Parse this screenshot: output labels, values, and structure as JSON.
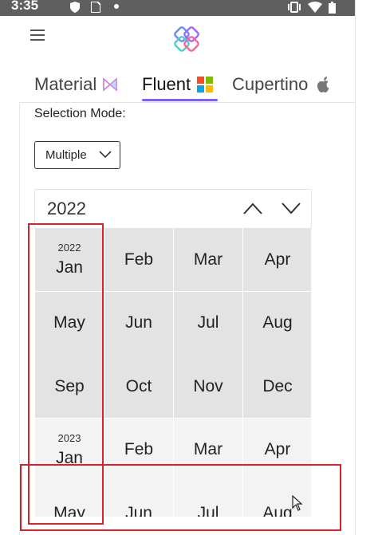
{
  "status": {
    "time": "3:35"
  },
  "tabs": [
    {
      "label": "Material",
      "icon": "material-icon"
    },
    {
      "label": "Fluent",
      "icon": "windows-icon"
    },
    {
      "label": "Cupertino",
      "icon": "apple-icon"
    }
  ],
  "selection_mode": {
    "label": "Selection Mode:",
    "value": "Multiple"
  },
  "calendar": {
    "header_year": "2022",
    "rows": [
      {
        "year_label": "2022",
        "months": [
          "Jan",
          "Feb",
          "Mar",
          "Apr"
        ]
      },
      {
        "year_label": "",
        "months": [
          "May",
          "Jun",
          "Jul",
          "Aug"
        ]
      },
      {
        "year_label": "",
        "months": [
          "Sep",
          "Oct",
          "Nov",
          "Dec"
        ]
      },
      {
        "year_label": "2023",
        "months": [
          "Jan",
          "Feb",
          "Mar",
          "Apr"
        ]
      },
      {
        "year_label": "",
        "months": [
          "May",
          "Jun",
          "Jul",
          "Aug"
        ]
      }
    ]
  },
  "colors": {
    "accent": "#7b61ff",
    "annotation": "#d9232b"
  }
}
